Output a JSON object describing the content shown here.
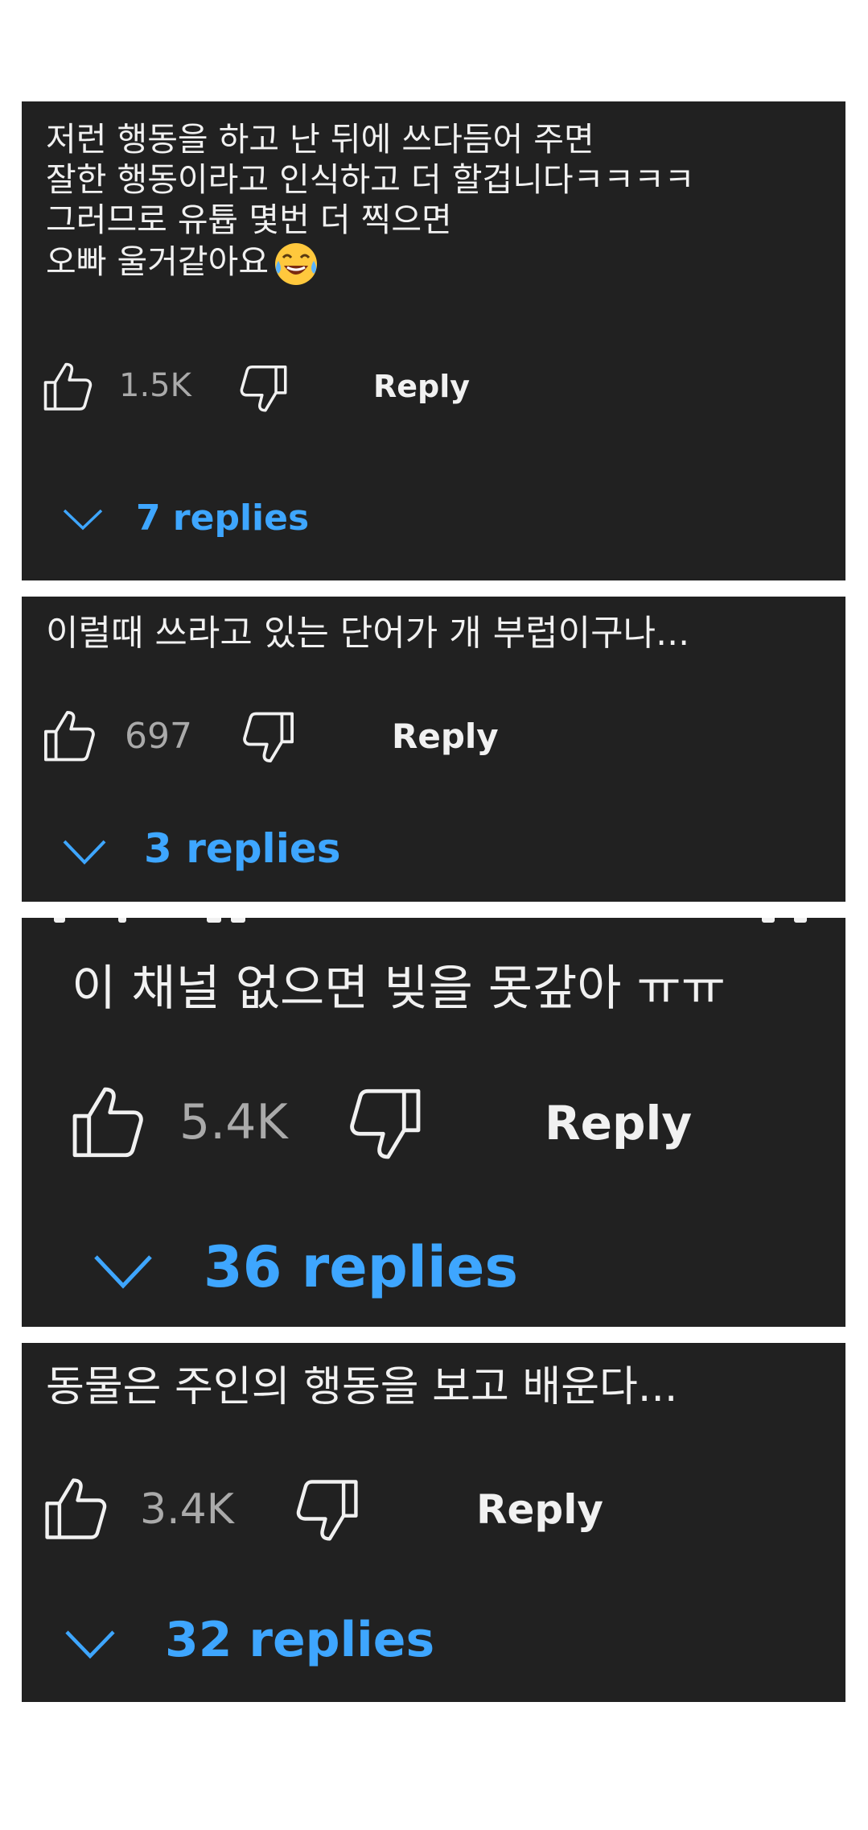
{
  "comments": [
    {
      "lines": [
        "저런 행동을 하고 난 뒤에 쓰다듬어 주면",
        "잘한 행동이라고 인식하고 더 할겁니다ㅋㅋㅋㅋ",
        "그러므로 유튭 몇번 더 찍으면",
        "오빠 울거같아요"
      ],
      "emoji": "laughing-tears-emoji",
      "likes": "1.5K",
      "reply_label": "Reply",
      "replies_label": "7 replies"
    },
    {
      "lines": [
        "이럴때 쓰라고 있는 단어가 개 부럽이구나..."
      ],
      "likes": "697",
      "reply_label": "Reply",
      "replies_label": "3 replies"
    },
    {
      "lines": [
        "이 채널 없으면 빚을 못갚아 ㅠㅠ"
      ],
      "likes": "5.4K",
      "reply_label": "Reply",
      "replies_label": "36 replies"
    },
    {
      "lines": [
        "동물은 주인의 행동을 보고 배운다..."
      ],
      "likes": "3.4K",
      "reply_label": "Reply",
      "replies_label": "32 replies"
    }
  ],
  "icons": {
    "like": "thumbs-up-icon",
    "dislike": "thumbs-down-icon",
    "expand": "chevron-down-icon"
  },
  "colors": {
    "panel_bg": "#212121",
    "text": "#f1f1f1",
    "count": "#aaaaaa",
    "replies": "#3ea6ff"
  }
}
